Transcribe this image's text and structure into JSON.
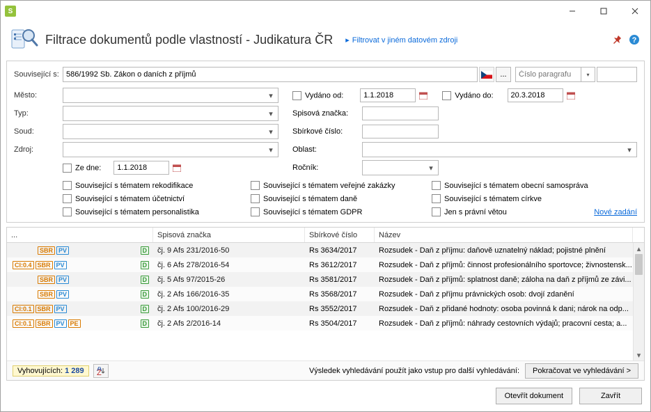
{
  "window": {
    "app_badge": "S",
    "title": "Filtrace dokumentů podle vlastností - Judikatura ČR",
    "alt_source_link": "Filtrovat v jiném datovém zdroji"
  },
  "row1": {
    "label": "Související s:",
    "value": "586/1992 Sb. Zákon o daních z příjmů",
    "paragraph_placeholder": "Číslo paragrafu"
  },
  "leftFields": {
    "mesto": "Město:",
    "typ": "Typ:",
    "soud": "Soud:",
    "zdroj": "Zdroj:",
    "ze_dne": "Ze dne:",
    "ze_dne_val": "1.1.2018"
  },
  "rightFields": {
    "vydano_od": "Vydáno od:",
    "vydano_od_val": "1.1.2018",
    "vydano_do": "Vydáno do:",
    "vydano_do_val": "20.3.2018",
    "spisova": "Spisová značka:",
    "sbirkove": "Sbírkové číslo:",
    "oblast": "Oblast:",
    "rocnik": "Ročník:"
  },
  "checks": {
    "rekod": "Související s tématem rekodifikace",
    "ucet": "Související s tématem účetnictví",
    "pers": "Související s tématem personalistika",
    "verej": "Související s tématem veřejné zakázky",
    "dane": "Související s tématem daně",
    "gdpr": "Související s tématem GDPR",
    "obec": "Související s tématem obecní samospráva",
    "cirkve": "Související s tématem církve",
    "pravni": "Jen s právní větou",
    "nove": "Nové zadání"
  },
  "grid": {
    "headers": {
      "h1": "...",
      "h2": "Spisová značka",
      "h3": "Sbírkové číslo",
      "h4": "Název"
    },
    "rows": [
      {
        "badges": [
          "SBR",
          "PV",
          "D"
        ],
        "sp": "čj. 9 Afs 231/2016-50",
        "sb": "Rs 3634/2017",
        "nm": "Rozsudek - Daň z příjmu: daňově uznatelný náklad; pojistné plnění"
      },
      {
        "badges": [
          "CI:0.4",
          "SBR",
          "PV",
          "D"
        ],
        "sp": "čj. 6 Afs 278/2016-54",
        "sb": "Rs 3612/2017",
        "nm": "Rozsudek - Daň z příjmů: činnost profesionálního sportovce; živnostensk..."
      },
      {
        "badges": [
          "SBR",
          "PV",
          "D"
        ],
        "sp": "čj. 5 Afs 97/2015-26",
        "sb": "Rs 3581/2017",
        "nm": "Rozsudek - Daň z příjmů: splatnost daně; záloha na daň z příjmů ze závi..."
      },
      {
        "badges": [
          "SBR",
          "PV",
          "D"
        ],
        "sp": "čj. 2 Afs 166/2016-35",
        "sb": "Rs 3568/2017",
        "nm": "Rozsudek - Daň z příjmu právnických osob: dvojí zdanění"
      },
      {
        "badges": [
          "CI:0.1",
          "SBR",
          "PV",
          "D"
        ],
        "sp": "čj. 2 Afs 100/2016-29",
        "sb": "Rs 3552/2017",
        "nm": "Rozsudek - Daň z přidané hodnoty: osoba povinná k dani; nárok na odp..."
      },
      {
        "badges": [
          "CI:0.1",
          "SBR",
          "PV",
          "PE",
          "D"
        ],
        "sp": "čj. 2 Afs 2/2016-14",
        "sb": "Rs 3504/2017",
        "nm": "Rozsudek - Daň z příjmů: náhrady cestovních výdajů; pracovní cesta; a..."
      }
    ]
  },
  "footer": {
    "count_label": "Vyhovujících:",
    "count_value": "1 289",
    "result_text": "Výsledek vyhledávání použít jako vstup pro další vyhledávání:",
    "continue_btn": "Pokračovat ve vyhledávání >"
  },
  "buttons": {
    "open": "Otevřít dokument",
    "close": "Zavřít"
  }
}
